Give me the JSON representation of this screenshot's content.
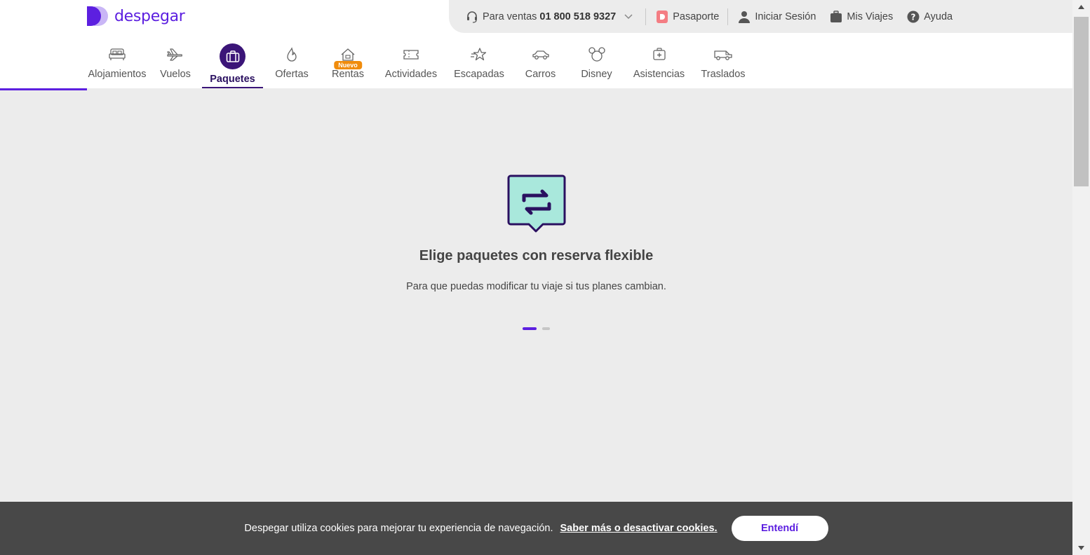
{
  "brand": {
    "name": "despegar",
    "color": "#5c1fe0"
  },
  "topbar": {
    "sales_label": "Para ventas",
    "sales_phone": "01 800 518 9327",
    "pasaporte": "Pasaporte",
    "login": "Iniciar Sesión",
    "trips": "Mis Viajes",
    "help": "Ayuda"
  },
  "nav": {
    "items": [
      {
        "label": "Alojamientos",
        "icon": "bed-icon"
      },
      {
        "label": "Vuelos",
        "icon": "plane-icon"
      },
      {
        "label": "Paquetes",
        "icon": "suitcase-icon",
        "active": true
      },
      {
        "label": "Ofertas",
        "icon": "flame-icon"
      },
      {
        "label": "Rentas",
        "icon": "house-icon",
        "badge": "Nuevo"
      },
      {
        "label": "Actividades",
        "icon": "ticket-icon"
      },
      {
        "label": "Escapadas",
        "icon": "star-icon"
      },
      {
        "label": "Carros",
        "icon": "car-icon"
      },
      {
        "label": "Disney",
        "icon": "mickey-icon"
      },
      {
        "label": "Asistencias",
        "icon": "medkit-icon"
      },
      {
        "label": "Traslados",
        "icon": "van-icon"
      }
    ]
  },
  "hero": {
    "title": "Elige paquetes con reserva flexible",
    "subtitle": "Para que puedas modificar tu viaje si tus planes cambian.",
    "carousel_index": 1,
    "carousel_total": 2
  },
  "cookie": {
    "message": "Despegar utiliza cookies para mejorar tu experiencia de navegación.",
    "link": "Saber más o desactivar cookies.",
    "button": "Entendí"
  },
  "colors": {
    "accent": "#5c1fe0",
    "active_nav": "#3b1578",
    "badge": "#f08c0c",
    "hero_icon_fill": "#a9e8dc"
  }
}
